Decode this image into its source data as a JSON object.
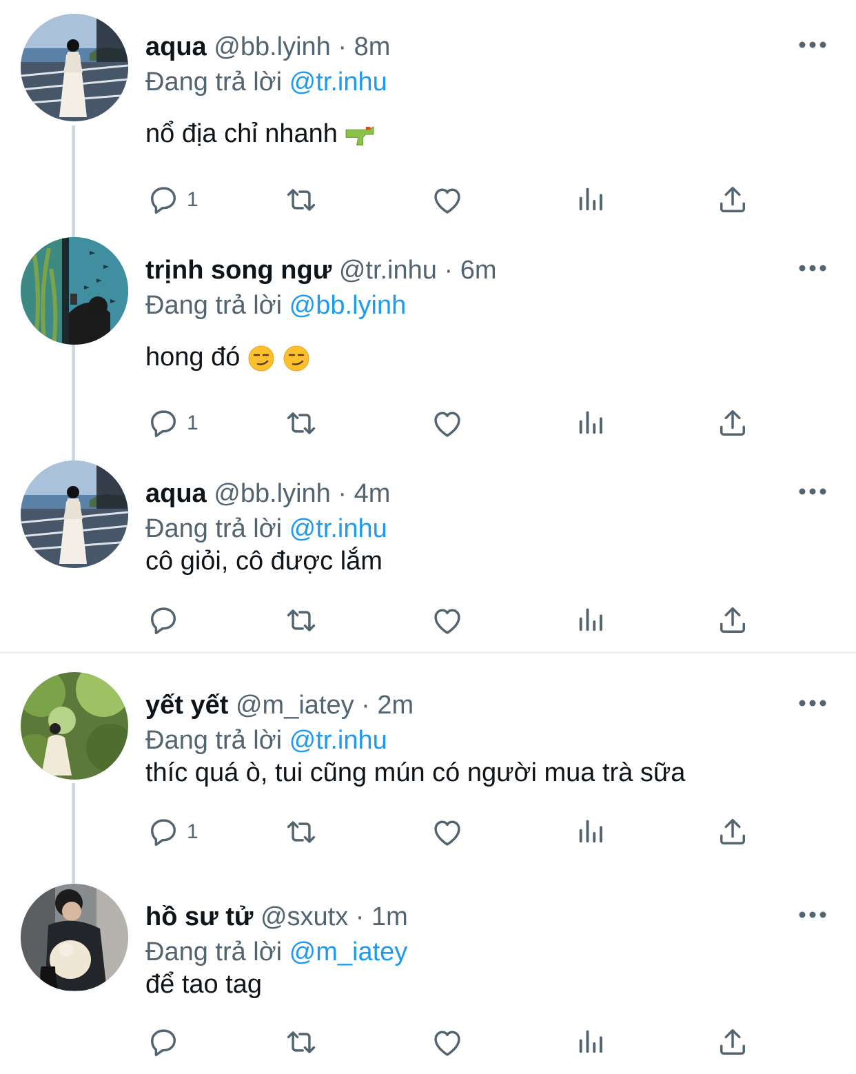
{
  "tweets": [
    {
      "name": "aqua",
      "handle": "@bb.lyinh",
      "sep": "·",
      "time": "8m",
      "reply_prefix": "Đang trả lời",
      "reply_to": "@tr.inhu",
      "text": "nổ địa chỉ nhanh",
      "emoji": "water-pistol",
      "reply_count": "1",
      "avatar": "seaside-girl"
    },
    {
      "name": "trịnh song ngư",
      "handle": "@tr.inhu",
      "sep": "·",
      "time": "6m",
      "reply_prefix": "Đang trả lời",
      "reply_to": "@bb.lyinh",
      "text": "hong đó",
      "emoji": "smirking-face x2",
      "reply_count": "1",
      "avatar": "aquarium-girl"
    },
    {
      "name": "aqua",
      "handle": "@bb.lyinh",
      "sep": "·",
      "time": "4m",
      "reply_prefix": "Đang trả lời",
      "reply_to": "@tr.inhu",
      "text": "cô giỏi, cô được lắm",
      "reply_count": "",
      "avatar": "seaside-girl"
    },
    {
      "name": "yết yết",
      "handle": "@m_iatey",
      "sep": "·",
      "time": "2m",
      "reply_prefix": "Đang trả lời",
      "reply_to": "@tr.inhu",
      "text": "thíc quá ò, tui cũng mún có người mua trà sữa",
      "reply_count": "1",
      "avatar": "forest-girl"
    },
    {
      "name": "hồ sư tử",
      "handle": "@sxutx",
      "sep": "·",
      "time": "1m",
      "reply_prefix": "Đang trả lời",
      "reply_to": "@m_iatey",
      "text": "để tao tag",
      "reply_count": "",
      "avatar": "boy-with-dog"
    }
  ],
  "colors": {
    "text": "#0f1419",
    "secondary": "#536471",
    "link": "#1d9bf0",
    "thread_line": "#cfd9de"
  },
  "icons": [
    "reply-icon",
    "retweet-icon",
    "like-icon",
    "stats-icon",
    "share-icon",
    "more-icon"
  ]
}
